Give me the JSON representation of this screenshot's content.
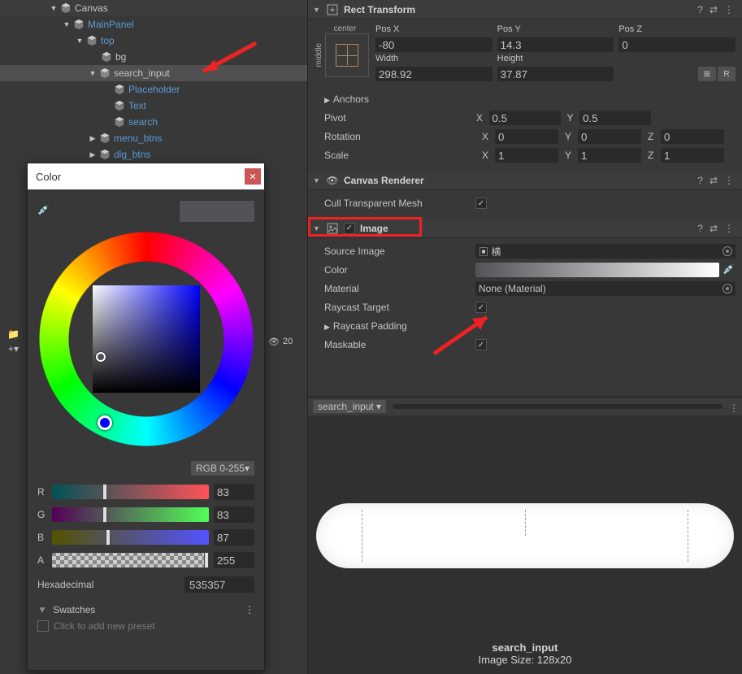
{
  "hierarchy": {
    "nodes": [
      {
        "label": "Canvas",
        "blue": false,
        "indent": 60,
        "fold": "▼"
      },
      {
        "label": "MainPanel",
        "blue": true,
        "indent": 76,
        "fold": "▼"
      },
      {
        "label": "top",
        "blue": true,
        "indent": 92,
        "fold": "▼"
      },
      {
        "label": "bg",
        "blue": false,
        "indent": 124,
        "fold": ""
      },
      {
        "label": "search_input",
        "blue": false,
        "indent": 108,
        "fold": "▼",
        "sel": true
      },
      {
        "label": "Placeholder",
        "blue": true,
        "indent": 140,
        "fold": ""
      },
      {
        "label": "Text",
        "blue": true,
        "indent": 140,
        "fold": ""
      },
      {
        "label": "search",
        "blue": true,
        "indent": 140,
        "fold": ""
      },
      {
        "label": "menu_btns",
        "blue": true,
        "indent": 108,
        "fold": "▶"
      },
      {
        "label": "dlg_btns",
        "blue": true,
        "indent": 108,
        "fold": "▶"
      }
    ]
  },
  "inspector": {
    "rect": {
      "title": "Rect Transform",
      "anchor_h": "center",
      "anchor_v": "middle",
      "posx_lbl": "Pos X",
      "posy_lbl": "Pos Y",
      "posz_lbl": "Pos Z",
      "posx": "-80",
      "posy": "14.3",
      "posz": "0",
      "w_lbl": "Width",
      "h_lbl": "Height",
      "w": "298.92",
      "h": "37.87",
      "anchors": "Anchors",
      "pivot": "Pivot",
      "pvx": "0.5",
      "pvy": "0.5",
      "rotation": "Rotation",
      "rx": "0",
      "ry": "0",
      "rz": "0",
      "scale": "Scale",
      "sx": "1",
      "sy": "1",
      "sz": "1"
    },
    "canvasr": {
      "title": "Canvas Renderer",
      "cull": "Cull Transparent Mesh"
    },
    "image": {
      "title": "Image",
      "src_lbl": "Source Image",
      "src_val": "横",
      "color_lbl": "Color",
      "mat_lbl": "Material",
      "mat_val": "None (Material)",
      "ray_lbl": "Raycast Target",
      "pad_lbl": "Raycast Padding",
      "mask_lbl": "Maskable"
    },
    "preview": {
      "tab": "search_input",
      "name": "search_input",
      "size": "Image Size: 128x20"
    }
  },
  "colorpicker": {
    "title": "Color",
    "mode": "RGB 0-255▾",
    "r_lbl": "R",
    "g_lbl": "G",
    "b_lbl": "B",
    "a_lbl": "A",
    "r": "83",
    "g": "83",
    "b": "87",
    "a": "255",
    "hex_lbl": "Hexadecimal",
    "hex": "535357",
    "swatches": "Swatches",
    "preset": "Click to add new preset"
  },
  "assets": {
    "count": "20",
    "folder": "F"
  }
}
